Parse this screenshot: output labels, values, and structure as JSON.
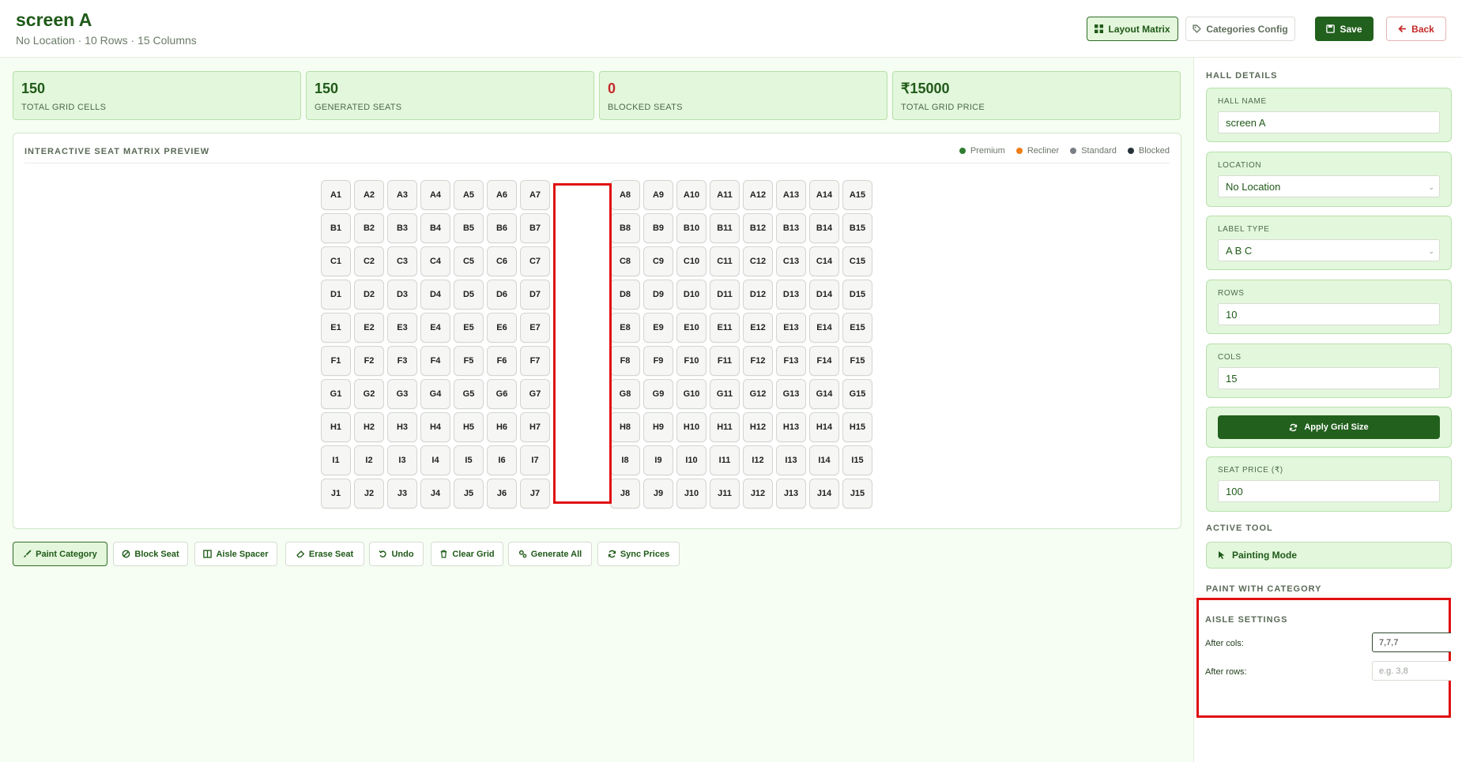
{
  "header": {
    "title": "screen A",
    "subtitle": "No Location · 10 Rows · 15 Columns",
    "layout_label": "Layout Matrix",
    "categories_label": "Categories Config",
    "save_label": "Save",
    "back_label": "Back"
  },
  "stats": [
    {
      "value": "150",
      "label": "TOTAL GRID CELLS"
    },
    {
      "value": "150",
      "label": "GENERATED SEATS"
    },
    {
      "value": "0",
      "label": "BLOCKED SEATS"
    },
    {
      "value": "₹15000",
      "label": "TOTAL GRID PRICE"
    }
  ],
  "matrix": {
    "title": "INTERACTIVE SEAT MATRIX PREVIEW",
    "legend": [
      {
        "label": "Premium",
        "color": "#2e7d32"
      },
      {
        "label": "Recliner",
        "color": "#ef7d18"
      },
      {
        "label": "Standard",
        "color": "#7a7f87"
      },
      {
        "label": "Blocked",
        "color": "#263238"
      }
    ],
    "rows": [
      "A",
      "B",
      "C",
      "D",
      "E",
      "F",
      "G",
      "H",
      "I",
      "J"
    ],
    "cols": 15,
    "aisle_after_col": 7
  },
  "toolbar": {
    "paint": "Paint Category",
    "block": "Block Seat",
    "aisle": "Aisle Spacer",
    "erase": "Erase Seat",
    "undo": "Undo",
    "clear": "Clear Grid",
    "generate": "Generate All",
    "sync": "Sync Prices"
  },
  "sidebar": {
    "hall_details_title": "HALL DETAILS",
    "hall_name_label": "HALL NAME",
    "hall_name_value": "screen A",
    "location_label": "LOCATION",
    "location_value": "No Location",
    "label_type_label": "LABEL TYPE",
    "label_type_value": "A B C",
    "rows_label": "ROWS",
    "rows_value": "10",
    "cols_label": "COLS",
    "cols_value": "15",
    "apply_label": "Apply Grid Size",
    "seat_price_label": "SEAT PRICE (₹)",
    "seat_price_value": "100",
    "active_tool_title": "ACTIVE TOOL",
    "active_tool_value": "Painting Mode",
    "paint_with_title": "PAINT WITH CATEGORY",
    "aisle_settings_title": "AISLE SETTINGS",
    "after_cols_label": "After cols:",
    "after_cols_value": "7,7,7",
    "after_rows_label": "After rows:",
    "after_rows_placeholder": "e.g. 3,8"
  }
}
